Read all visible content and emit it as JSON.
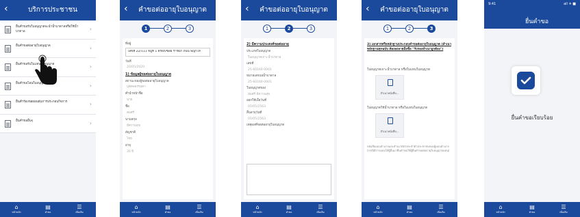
{
  "colors": {
    "brand": "#1b4a9c",
    "background": "#f3f4f8"
  },
  "screen1": {
    "title": "บริการประชาชน",
    "menu": [
      "ยื่นคำขอรับใบอนุญาตจะนำน้ำบาดาลหรือใช้น้ำบาดาล",
      "ยื่นคำขอต่ออายุใบอนุญาต",
      "ยื่นคำขอรับใบแทนใบอนุญาต",
      "ยื่นคำขอโอนใบอนุญาต",
      "ยื่นคำร้องขอผ่อนผันการประกอบกิจการ",
      "ยื่นคำขออื่นๆ"
    ]
  },
  "screen2": {
    "title": "คำขอต่ออายุใบอนุญาต",
    "steps": [
      "1",
      "2",
      "3"
    ],
    "fields": {
      "address_label": "ที่อยู่",
      "address_value": "เลขที่ 22/111 หมู่ที่ 1 ตรอก/ซอย ราชน้ำ ถนน พญาไท",
      "date_label": "วันที่",
      "date_value": "20/05/2020",
      "section": "1) ข้อมูลผู้ขอต่ออายุใบอนุญาต",
      "place_label": "สถานะของผู้ขอต่ออายุใบอนุญาต",
      "place_value": "บุคคลธรรมดา",
      "prefix_label": "คำนำหน้าชื่อ",
      "prefix_value": "นาย",
      "name_label": "ชื่อ",
      "name_value": "สมศรี",
      "surname_label": "นามสกุล",
      "surname_value": "มีความสุข",
      "nation_label": "สัญชาติ",
      "nation_value": "ไทย",
      "age_label": "อายุ",
      "age_value": "30 ปี"
    }
  },
  "screen3": {
    "title": "คำขอต่ออายุใบอนุญาต",
    "section": "2) มีความประสงค์ขอต่ออายุ",
    "fields": {
      "type_label": "ประเภทใบอนุญาต",
      "type_value": "ใบอนุญาตเจาะน้ำบาดาล",
      "no_label": "เลขที่",
      "no_value": "25-60160-0001",
      "reqno_label": "หมายเลขบ่อน้ำบาดาล",
      "reqno_value": "25-60160-0001",
      "issuer_label": "ใบอนุญาตของ",
      "issuer_value": "สมศรี มีความสุข",
      "issue_label": "ออกให้เมื่อวันที่",
      "issue_value": "05/05/2563",
      "expire_label": "สิ้นอายุวันที่",
      "expire_value": "05/05/2563",
      "reason_label": "เหตุผลที่ขอต่ออายุใบอนุญาต"
    }
  },
  "screen4": {
    "title": "คำขอต่ออายุใบอนุญาต",
    "section": "3) เอกสารหรือหลักฐานประกอบคำขอต่ออายุใบอนุญาต (สำเนาหลักฐานทุกฉบับ ต้องลงลายมือชื่อ \"รับรองสำเนาถูกต้อง\")",
    "doc1_label": "ใบอนุญาตเจาะน้ำบาดาล หรือใบแทนใบอนุญาต",
    "doc1_file": "สำเนาหนังสือ...",
    "doc2_label": "ใบอนุญาตใช้น้ำบาดาล หรือใบแทนใบอนุญาต",
    "doc2_file": "สำเนาหนังสือ...",
    "footnote": "หนังสือมอบอำนาจและสำเนาบัตรประจำตัวประชาชนของผู้มอบอำนาจ (กรณีมีการมอบให้ผู้อื่นมายื่นคำขอใช้ผู้ยื่นคำขอต่ออายุใบอนุญาตแทน)"
  },
  "screen5": {
    "status_time": "9:41",
    "status_signal": "all ✈ ■",
    "title": "ยื่นคำขอ",
    "message": "ยื่นคำขอเรียบร้อย"
  },
  "tabs": [
    "หน้าหลัก",
    "คำขอ",
    "เพิ่มเติม"
  ]
}
